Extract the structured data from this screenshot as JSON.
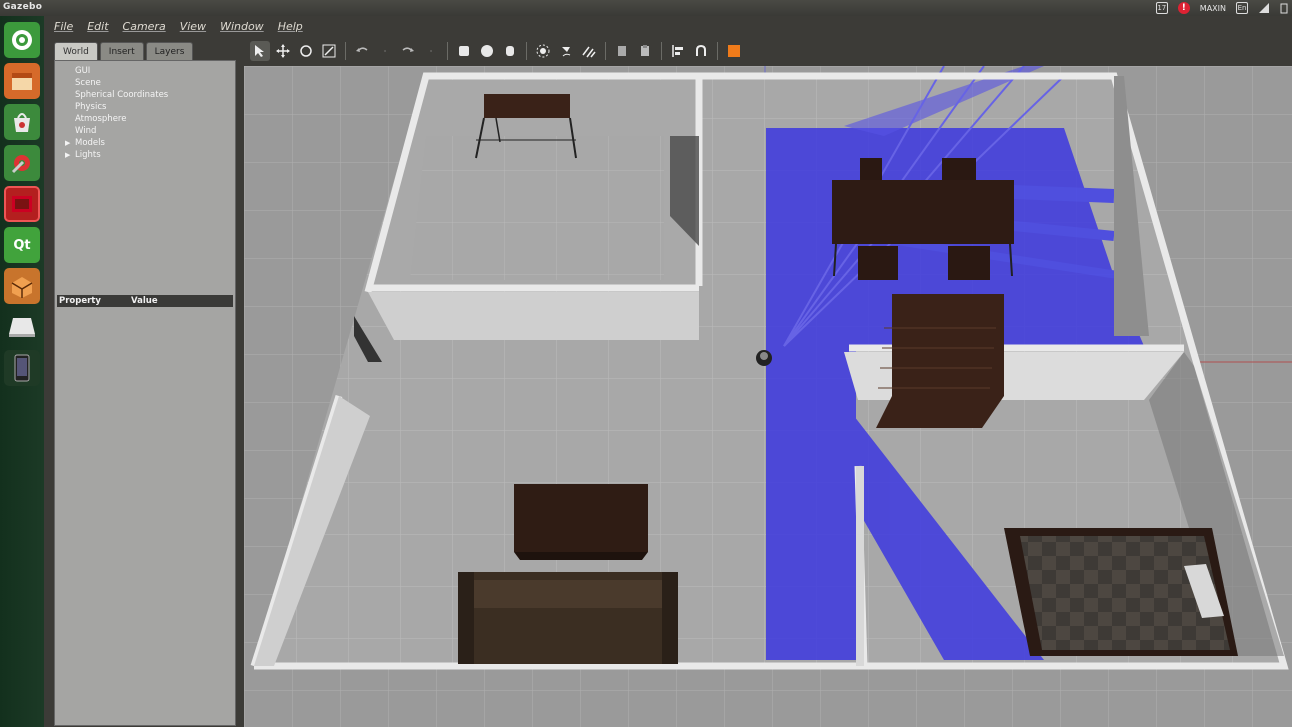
{
  "topbar": {
    "app_title": "Gazebo",
    "tray_box_1": "17",
    "tray_user": "MAXIN",
    "tray_box_2": "En",
    "tray_alert": "!"
  },
  "menu": {
    "items": [
      "File",
      "Edit",
      "Camera",
      "View",
      "Window",
      "Help"
    ]
  },
  "tabs": [
    "World",
    "Insert",
    "Layers"
  ],
  "tree": {
    "items": [
      "GUI",
      "Scene",
      "Spherical Coordinates",
      "Physics",
      "Atmosphere",
      "Wind",
      "Models",
      "Lights"
    ]
  },
  "properties": {
    "col_property": "Property",
    "col_value": "Value"
  },
  "toolbar": {
    "icons": [
      "select-arrow-icon",
      "translate-icon",
      "rotate-icon",
      "scale-icon",
      "undo-icon",
      "undo-dropdown-icon",
      "redo-icon",
      "redo-dropdown-icon",
      "box-shape-icon",
      "sphere-shape-icon",
      "cylinder-shape-icon",
      "point-light-icon",
      "spot-light-icon",
      "directional-light-icon",
      "copy-icon",
      "paste-icon",
      "align-icon",
      "snap-icon",
      "screenshot-icon"
    ],
    "accent_color": "#f07b1a"
  },
  "launcher": {
    "items": [
      "ubuntu-dash-icon",
      "files-icon",
      "software-center-icon",
      "system-settings-icon",
      "presentation-icon",
      "qt-creator-icon",
      "gazebo-icon",
      "drive-icon",
      "device-icon"
    ]
  },
  "scene": {
    "floor_color": "#9a9a9a",
    "wall_color": "#e6e6e6",
    "laser_color": "#3d38e0",
    "furniture_color": "#3a2218"
  }
}
